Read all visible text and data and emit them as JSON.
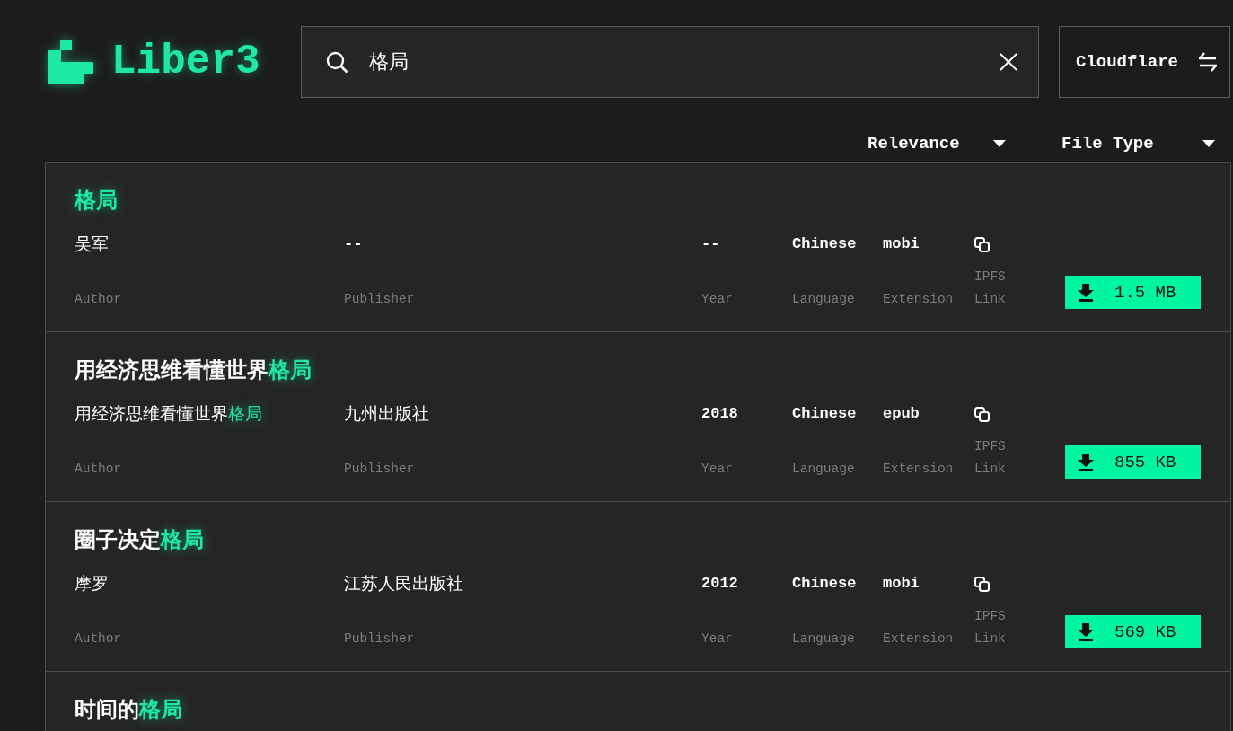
{
  "logo": {
    "text": "Liber3"
  },
  "search": {
    "value": "格局"
  },
  "gateway_button": {
    "label": "Cloudflare"
  },
  "sort_controls": [
    {
      "label": "Relevance"
    },
    {
      "label": "File Type"
    }
  ],
  "results": [
    {
      "title": [
        {
          "text": "格局",
          "highlight": true
        }
      ],
      "fields": [
        {
          "kind": "text",
          "value": [
            {
              "text": "吴军",
              "highlight": false
            }
          ],
          "label": "Author"
        },
        {
          "kind": "code",
          "value": [
            {
              "text": "--",
              "highlight": false
            }
          ],
          "label": "Publisher"
        },
        {
          "kind": "code",
          "value": [
            {
              "text": "--",
              "highlight": false
            }
          ],
          "label": "Year"
        },
        {
          "kind": "code",
          "value": [
            {
              "text": "Chinese",
              "highlight": false
            }
          ],
          "label": "Language"
        },
        {
          "kind": "code",
          "value": [
            {
              "text": "mobi",
              "highlight": false
            }
          ],
          "label": "Extension"
        },
        {
          "kind": "link",
          "label": "IPFS Link"
        }
      ],
      "download": {
        "size": "1.5 MB"
      }
    },
    {
      "title": [
        {
          "text": "用经济思维看懂世界",
          "highlight": false
        },
        {
          "text": "格局",
          "highlight": true
        }
      ],
      "fields": [
        {
          "kind": "text",
          "value": [
            {
              "text": "用经济思维看懂世界",
              "highlight": false
            },
            {
              "text": "格局",
              "highlight": true
            }
          ],
          "label": "Author"
        },
        {
          "kind": "text",
          "value": [
            {
              "text": "九州出版社",
              "highlight": false
            }
          ],
          "label": "Publisher"
        },
        {
          "kind": "code",
          "value": [
            {
              "text": "2018",
              "highlight": false
            }
          ],
          "label": "Year"
        },
        {
          "kind": "code",
          "value": [
            {
              "text": "Chinese",
              "highlight": false
            }
          ],
          "label": "Language"
        },
        {
          "kind": "code",
          "value": [
            {
              "text": "epub",
              "highlight": false
            }
          ],
          "label": "Extension"
        },
        {
          "kind": "link",
          "label": "IPFS Link"
        }
      ],
      "download": {
        "size": "855 KB"
      }
    },
    {
      "title": [
        {
          "text": "圈子决定",
          "highlight": false
        },
        {
          "text": "格局",
          "highlight": true
        }
      ],
      "fields": [
        {
          "kind": "text",
          "value": [
            {
              "text": "摩罗",
              "highlight": false
            }
          ],
          "label": "Author"
        },
        {
          "kind": "text",
          "value": [
            {
              "text": "江苏人民出版社",
              "highlight": false
            }
          ],
          "label": "Publisher"
        },
        {
          "kind": "code",
          "value": [
            {
              "text": "2012",
              "highlight": false
            }
          ],
          "label": "Year"
        },
        {
          "kind": "code",
          "value": [
            {
              "text": "Chinese",
              "highlight": false
            }
          ],
          "label": "Language"
        },
        {
          "kind": "code",
          "value": [
            {
              "text": "mobi",
              "highlight": false
            }
          ],
          "label": "Extension"
        },
        {
          "kind": "link",
          "label": "IPFS Link"
        }
      ],
      "download": {
        "size": "569 KB"
      }
    },
    {
      "title": [
        {
          "text": "时间的",
          "highlight": false
        },
        {
          "text": "格局",
          "highlight": true
        }
      ]
    }
  ]
}
